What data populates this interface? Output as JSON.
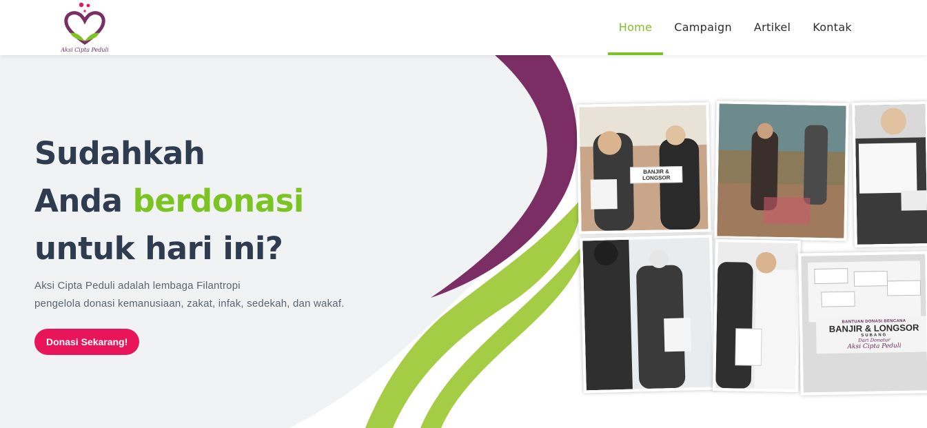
{
  "header": {
    "logo_text": "Aksi Cipta Peduli",
    "nav": [
      {
        "label": "Home",
        "active": true
      },
      {
        "label": "Campaign",
        "active": false
      },
      {
        "label": "Artikel",
        "active": false
      },
      {
        "label": "Kontak",
        "active": false
      }
    ]
  },
  "hero": {
    "headline_line1": "Sudahkah",
    "headline_line2_prefix": "Anda ",
    "headline_line2_accent": "berdonasi",
    "headline_line3": "untuk hari ini?",
    "description_line1": "Aksi Cipta Peduli adalah lembaga Filantropi",
    "description_line2": "pengelola donasi kemanusiaan, zakat, infak, sedekah, dan wakaf.",
    "cta_label": "Donasi Sekarang!"
  },
  "photos": {
    "sign_small": "BANTUAN DONASI BENCANA",
    "sign_big": "BANJIR & LONGSOR",
    "sign_sub": "SUBANG",
    "sign_donor": "Dari Donatur",
    "sign_org": "Aksi Cipta Peduli"
  },
  "colors": {
    "accent_green": "#7cc424",
    "brand_purple": "#7a2e63",
    "cta_pink": "#e8155b",
    "headline_dark": "#2f3b4f"
  }
}
